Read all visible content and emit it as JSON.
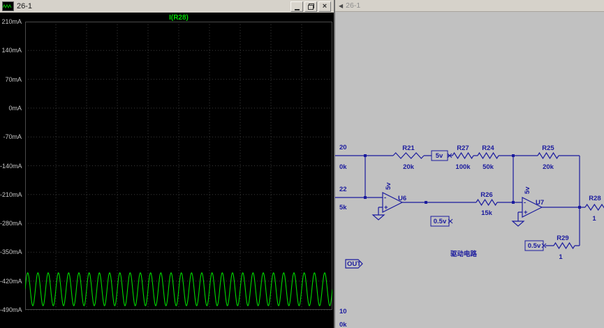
{
  "window": {
    "plot_pane_title": "26-1",
    "schematic_pane_title": "26-1",
    "close_glyph": "×"
  },
  "plot": {
    "trace_title": "I(R28)",
    "y_tick_labels": [
      "210mA",
      "140mA",
      "70mA",
      "0mA",
      "-70mA",
      "-140mA",
      "-210mA",
      "-280mA",
      "-350mA",
      "-420mA",
      "-490mA"
    ]
  },
  "chart_data": {
    "type": "line",
    "title": "I(R28)",
    "ylim_mA": [
      -490,
      210
    ],
    "y_tick_step_mA": 70,
    "grid": true,
    "background": "#000000",
    "legend_position": "top-center",
    "series": [
      {
        "name": "I(R28)",
        "shape": "sine",
        "center_mA": -440,
        "amplitude_mA": 40,
        "cycles_visible": 30,
        "color": "#00d800"
      }
    ]
  },
  "schematic": {
    "components": {
      "r21": {
        "name": "R21",
        "value": "20k"
      },
      "r24": {
        "name": "R24",
        "value": "50k"
      },
      "r25": {
        "name": "R25",
        "value": "20k"
      },
      "r26": {
        "name": "R26",
        "value": "15k"
      },
      "r27": {
        "name": "R27",
        "value": "100k"
      },
      "r28": {
        "name": "R28",
        "value": "1"
      },
      "r29": {
        "name": "R29",
        "value": "1"
      },
      "u6": {
        "name": "U6",
        "supply": "5v"
      },
      "u7": {
        "name": "U7",
        "supply": "5v"
      }
    },
    "flags": {
      "v5": "5v",
      "v05_a": "0.5v",
      "v05_b": "0.5v",
      "out_port": "OUT"
    },
    "annotation": "驱动电路",
    "opamp_minus": "-",
    "opamp_plus": "+",
    "edge_partial_labels": {
      "top_name": "20",
      "top_value": "0k",
      "mid_name": "22",
      "mid_value": "5k",
      "bottom_name": "10",
      "bottom_value": "0k"
    }
  }
}
